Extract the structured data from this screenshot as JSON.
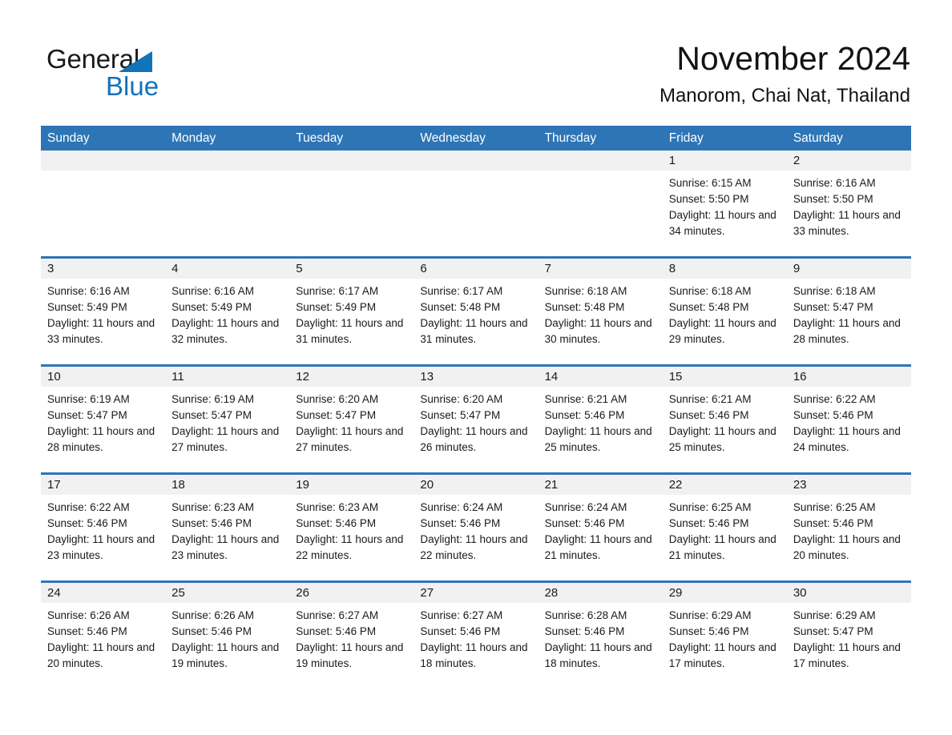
{
  "brand": {
    "name_part1": "General",
    "name_part2": "Blue",
    "triangle_color": "#1173ba",
    "text_color": "#1a1a1a"
  },
  "header": {
    "title": "November 2024",
    "location": "Manorom, Chai Nat, Thailand"
  },
  "theme": {
    "header_blue": "#2e75b6",
    "daynum_band": "#f1f1f1",
    "page_background": "#ffffff",
    "body_text": "#1a1a1a"
  },
  "weekdays": [
    "Sunday",
    "Monday",
    "Tuesday",
    "Wednesday",
    "Thursday",
    "Friday",
    "Saturday"
  ],
  "weeks": [
    [
      {
        "day": "",
        "sunrise": "",
        "sunset": "",
        "daylight": "",
        "empty": true
      },
      {
        "day": "",
        "sunrise": "",
        "sunset": "",
        "daylight": "",
        "empty": true
      },
      {
        "day": "",
        "sunrise": "",
        "sunset": "",
        "daylight": "",
        "empty": true
      },
      {
        "day": "",
        "sunrise": "",
        "sunset": "",
        "daylight": "",
        "empty": true
      },
      {
        "day": "",
        "sunrise": "",
        "sunset": "",
        "daylight": "",
        "empty": true
      },
      {
        "day": "1",
        "sunrise": "Sunrise: 6:15 AM",
        "sunset": "Sunset: 5:50 PM",
        "daylight": "Daylight: 11 hours and 34 minutes.",
        "empty": false
      },
      {
        "day": "2",
        "sunrise": "Sunrise: 6:16 AM",
        "sunset": "Sunset: 5:50 PM",
        "daylight": "Daylight: 11 hours and 33 minutes.",
        "empty": false
      }
    ],
    [
      {
        "day": "3",
        "sunrise": "Sunrise: 6:16 AM",
        "sunset": "Sunset: 5:49 PM",
        "daylight": "Daylight: 11 hours and 33 minutes.",
        "empty": false
      },
      {
        "day": "4",
        "sunrise": "Sunrise: 6:16 AM",
        "sunset": "Sunset: 5:49 PM",
        "daylight": "Daylight: 11 hours and 32 minutes.",
        "empty": false
      },
      {
        "day": "5",
        "sunrise": "Sunrise: 6:17 AM",
        "sunset": "Sunset: 5:49 PM",
        "daylight": "Daylight: 11 hours and 31 minutes.",
        "empty": false
      },
      {
        "day": "6",
        "sunrise": "Sunrise: 6:17 AM",
        "sunset": "Sunset: 5:48 PM",
        "daylight": "Daylight: 11 hours and 31 minutes.",
        "empty": false
      },
      {
        "day": "7",
        "sunrise": "Sunrise: 6:18 AM",
        "sunset": "Sunset: 5:48 PM",
        "daylight": "Daylight: 11 hours and 30 minutes.",
        "empty": false
      },
      {
        "day": "8",
        "sunrise": "Sunrise: 6:18 AM",
        "sunset": "Sunset: 5:48 PM",
        "daylight": "Daylight: 11 hours and 29 minutes.",
        "empty": false
      },
      {
        "day": "9",
        "sunrise": "Sunrise: 6:18 AM",
        "sunset": "Sunset: 5:47 PM",
        "daylight": "Daylight: 11 hours and 28 minutes.",
        "empty": false
      }
    ],
    [
      {
        "day": "10",
        "sunrise": "Sunrise: 6:19 AM",
        "sunset": "Sunset: 5:47 PM",
        "daylight": "Daylight: 11 hours and 28 minutes.",
        "empty": false
      },
      {
        "day": "11",
        "sunrise": "Sunrise: 6:19 AM",
        "sunset": "Sunset: 5:47 PM",
        "daylight": "Daylight: 11 hours and 27 minutes.",
        "empty": false
      },
      {
        "day": "12",
        "sunrise": "Sunrise: 6:20 AM",
        "sunset": "Sunset: 5:47 PM",
        "daylight": "Daylight: 11 hours and 27 minutes.",
        "empty": false
      },
      {
        "day": "13",
        "sunrise": "Sunrise: 6:20 AM",
        "sunset": "Sunset: 5:47 PM",
        "daylight": "Daylight: 11 hours and 26 minutes.",
        "empty": false
      },
      {
        "day": "14",
        "sunrise": "Sunrise: 6:21 AM",
        "sunset": "Sunset: 5:46 PM",
        "daylight": "Daylight: 11 hours and 25 minutes.",
        "empty": false
      },
      {
        "day": "15",
        "sunrise": "Sunrise: 6:21 AM",
        "sunset": "Sunset: 5:46 PM",
        "daylight": "Daylight: 11 hours and 25 minutes.",
        "empty": false
      },
      {
        "day": "16",
        "sunrise": "Sunrise: 6:22 AM",
        "sunset": "Sunset: 5:46 PM",
        "daylight": "Daylight: 11 hours and 24 minutes.",
        "empty": false
      }
    ],
    [
      {
        "day": "17",
        "sunrise": "Sunrise: 6:22 AM",
        "sunset": "Sunset: 5:46 PM",
        "daylight": "Daylight: 11 hours and 23 minutes.",
        "empty": false
      },
      {
        "day": "18",
        "sunrise": "Sunrise: 6:23 AM",
        "sunset": "Sunset: 5:46 PM",
        "daylight": "Daylight: 11 hours and 23 minutes.",
        "empty": false
      },
      {
        "day": "19",
        "sunrise": "Sunrise: 6:23 AM",
        "sunset": "Sunset: 5:46 PM",
        "daylight": "Daylight: 11 hours and 22 minutes.",
        "empty": false
      },
      {
        "day": "20",
        "sunrise": "Sunrise: 6:24 AM",
        "sunset": "Sunset: 5:46 PM",
        "daylight": "Daylight: 11 hours and 22 minutes.",
        "empty": false
      },
      {
        "day": "21",
        "sunrise": "Sunrise: 6:24 AM",
        "sunset": "Sunset: 5:46 PM",
        "daylight": "Daylight: 11 hours and 21 minutes.",
        "empty": false
      },
      {
        "day": "22",
        "sunrise": "Sunrise: 6:25 AM",
        "sunset": "Sunset: 5:46 PM",
        "daylight": "Daylight: 11 hours and 21 minutes.",
        "empty": false
      },
      {
        "day": "23",
        "sunrise": "Sunrise: 6:25 AM",
        "sunset": "Sunset: 5:46 PM",
        "daylight": "Daylight: 11 hours and 20 minutes.",
        "empty": false
      }
    ],
    [
      {
        "day": "24",
        "sunrise": "Sunrise: 6:26 AM",
        "sunset": "Sunset: 5:46 PM",
        "daylight": "Daylight: 11 hours and 20 minutes.",
        "empty": false
      },
      {
        "day": "25",
        "sunrise": "Sunrise: 6:26 AM",
        "sunset": "Sunset: 5:46 PM",
        "daylight": "Daylight: 11 hours and 19 minutes.",
        "empty": false
      },
      {
        "day": "26",
        "sunrise": "Sunrise: 6:27 AM",
        "sunset": "Sunset: 5:46 PM",
        "daylight": "Daylight: 11 hours and 19 minutes.",
        "empty": false
      },
      {
        "day": "27",
        "sunrise": "Sunrise: 6:27 AM",
        "sunset": "Sunset: 5:46 PM",
        "daylight": "Daylight: 11 hours and 18 minutes.",
        "empty": false
      },
      {
        "day": "28",
        "sunrise": "Sunrise: 6:28 AM",
        "sunset": "Sunset: 5:46 PM",
        "daylight": "Daylight: 11 hours and 18 minutes.",
        "empty": false
      },
      {
        "day": "29",
        "sunrise": "Sunrise: 6:29 AM",
        "sunset": "Sunset: 5:46 PM",
        "daylight": "Daylight: 11 hours and 17 minutes.",
        "empty": false
      },
      {
        "day": "30",
        "sunrise": "Sunrise: 6:29 AM",
        "sunset": "Sunset: 5:47 PM",
        "daylight": "Daylight: 11 hours and 17 minutes.",
        "empty": false
      }
    ]
  ]
}
